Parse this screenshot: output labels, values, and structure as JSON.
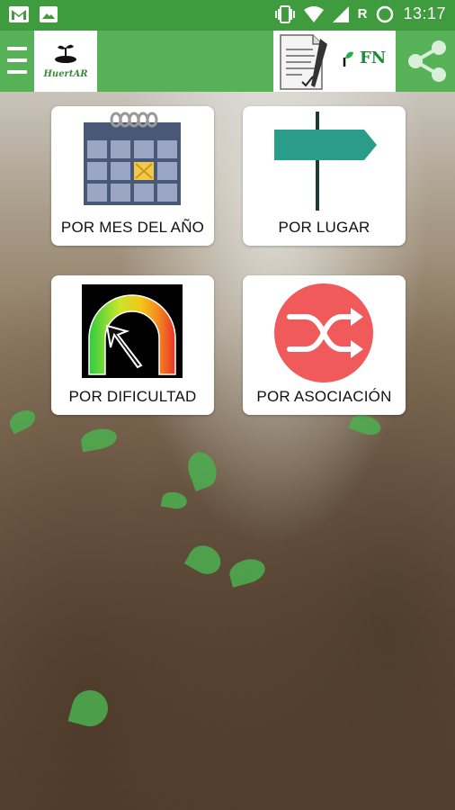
{
  "status_bar": {
    "icons_left": [
      "gmail-icon",
      "image-icon"
    ],
    "icons_right": [
      "vibrate-icon",
      "wifi-icon",
      "signal-icon",
      "roaming-indicator",
      "battery-icon"
    ],
    "roaming": "R",
    "time": "13:17"
  },
  "app_bar": {
    "logo_text": "HuertAR",
    "fn_label": "FN",
    "icons": [
      "menu-icon",
      "sprout-logo-icon",
      "document-sign-icon",
      "share-icon"
    ]
  },
  "cards": [
    {
      "label": "POR MES DEL AÑO",
      "icon": "calendar-icon"
    },
    {
      "label": "POR LUGAR",
      "icon": "signpost-icon"
    },
    {
      "label": "POR DIFICULTAD",
      "icon": "gauge-icon"
    },
    {
      "label": "POR ASOCIACIÓN",
      "icon": "shuffle-icon"
    }
  ],
  "colors": {
    "status_bar": "#3e9b3e",
    "app_bar": "#57b157",
    "signpost": "#2a9d8a",
    "shuffle_circle": "#f05a5a"
  }
}
